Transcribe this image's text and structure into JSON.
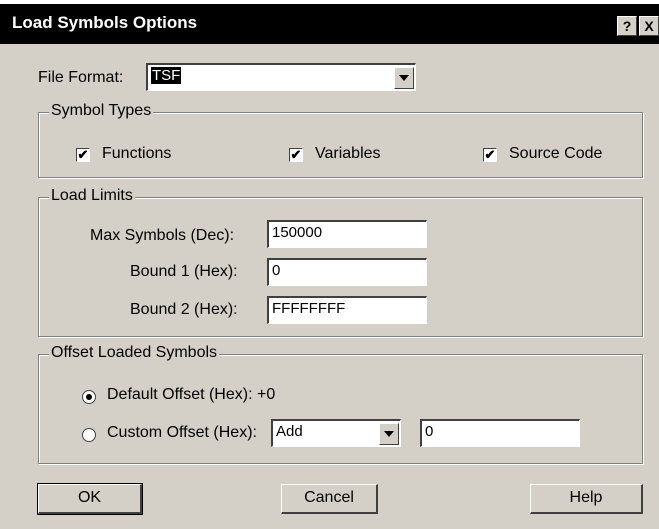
{
  "window": {
    "title": "Load Symbols Options",
    "help_button": "?",
    "close_button": "X"
  },
  "file_format": {
    "label": "File Format:",
    "value": "TSF"
  },
  "symbol_types": {
    "legend": "Symbol Types",
    "functions": {
      "label": "Functions",
      "checked": true
    },
    "variables": {
      "label": "Variables",
      "checked": true
    },
    "source_code": {
      "label": "Source Code",
      "checked": true
    }
  },
  "load_limits": {
    "legend": "Load Limits",
    "max_symbols": {
      "label": "Max Symbols (Dec):",
      "value": "150000"
    },
    "bound1": {
      "label": "Bound 1 (Hex):",
      "value": "0"
    },
    "bound2": {
      "label": "Bound 2 (Hex):",
      "value": "FFFFFFFF"
    }
  },
  "offset": {
    "legend": "Offset Loaded Symbols",
    "default_offset": {
      "label": "Default Offset (Hex): +0",
      "selected": true
    },
    "custom_offset": {
      "label": "Custom Offset (Hex):",
      "selected": false
    },
    "operation_value": "Add",
    "custom_value": "0"
  },
  "buttons": {
    "ok": "OK",
    "cancel": "Cancel",
    "help": "Help"
  },
  "check_mark": "✔"
}
